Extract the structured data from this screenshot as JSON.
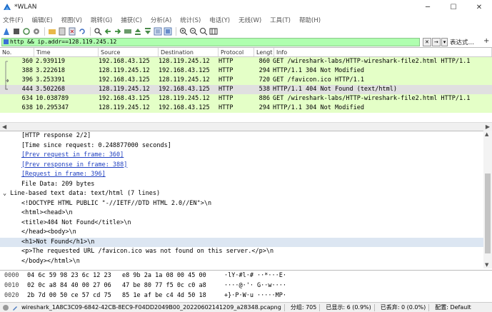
{
  "window": {
    "title": "*WLAN",
    "minimize": "─",
    "maximize": "☐",
    "close": "✕"
  },
  "menu": [
    "文件(F)",
    "编辑(E)",
    "视图(V)",
    "跳转(G)",
    "捕获(C)",
    "分析(A)",
    "统计(S)",
    "电话(Y)",
    "无线(W)",
    "工具(T)",
    "帮助(H)"
  ],
  "filter": {
    "value": "http && ip.addr==128.119.245.12",
    "clear": "✕",
    "apply": "→",
    "dropdown": "▾",
    "expressions_label": "表达式…",
    "add_label": "+"
  },
  "packet_list": {
    "headers": {
      "no": "No.",
      "time": "Time",
      "source": "Source",
      "destination": "Destination",
      "protocol": "Protocol",
      "length": "Lengt",
      "info": "Info"
    },
    "rows": [
      {
        "no": "360",
        "time": "2.939119",
        "source": "192.168.43.125",
        "destination": "128.119.245.12",
        "protocol": "HTTP",
        "length": "860",
        "info": "GET /wireshark-labs/HTTP-wireshark-file2.html HTTP/1.1"
      },
      {
        "no": "388",
        "time": "3.222618",
        "source": "128.119.245.12",
        "destination": "192.168.43.125",
        "protocol": "HTTP",
        "length": "294",
        "info": "HTTP/1.1 304 Not Modified"
      },
      {
        "no": "396",
        "time": "3.253391",
        "source": "192.168.43.125",
        "destination": "128.119.245.12",
        "protocol": "HTTP",
        "length": "720",
        "info": "GET /favicon.ico HTTP/1.1"
      },
      {
        "no": "444",
        "time": "3.502268",
        "source": "128.119.245.12",
        "destination": "192.168.43.125",
        "protocol": "HTTP",
        "length": "538",
        "info": "HTTP/1.1 404 Not Found  (text/html)"
      },
      {
        "no": "634",
        "time": "10.038789",
        "source": "192.168.43.125",
        "destination": "128.119.245.12",
        "protocol": "HTTP",
        "length": "886",
        "info": "GET /wireshark-labs/HTTP-wireshark-file2.html HTTP/1.1"
      },
      {
        "no": "638",
        "time": "10.295347",
        "source": "128.119.245.12",
        "destination": "192.168.43.125",
        "protocol": "HTTP",
        "length": "294",
        "info": "HTTP/1.1 304 Not Modified"
      }
    ]
  },
  "details": {
    "lines": [
      "[HTTP response 2/2]",
      "[Time since request: 0.248877000 seconds]",
      "[Prev request in frame: 360]",
      "[Prev response in frame: 388]",
      "[Request in frame: 396]",
      "File Data: 209 bytes",
      "Line-based text data: text/html (7 lines)",
      "<!DOCTYPE HTML PUBLIC \"-//IETF//DTD HTML 2.0//EN\">\\n",
      "<html><head>\\n",
      "<title>404 Not Found</title>\\n",
      "</head><body>\\n",
      "<h1>Not Found</h1>\\n",
      "<p>The requested URL /favicon.ico was not found on this server.</p>\\n",
      "</body></html>\\n"
    ]
  },
  "bytes": {
    "rows": [
      {
        "offset": "0000",
        "hex": "04 6c 59 98 23 6c 12 23   e8 9b 2a 1a 08 00 45 00",
        "ascii": "·lY·#l·# ··*···E·"
      },
      {
        "offset": "0010",
        "hex": "02 0c a8 84 40 00 27 06   47 be 80 77 f5 0c c0 a8",
        "ascii": "····@·'· G··w····"
      },
      {
        "offset": "0020",
        "hex": "2b 7d 00 50 ce 57 cd 75   85 1e af be c4 4d 50 18",
        "ascii": "+}·P·W·u ·····MP·"
      }
    ]
  },
  "status": {
    "file": "wireshark_1A8C3C09-6842-42CB-8EC9-F04DD2049B00_20220602141209_a28348.pcapng",
    "packets": "分组: 705",
    "displayed": "已显示: 6 (0.9%)",
    "dropped": "已丢弃: 0 (0.0%)",
    "profile": "配置: Default"
  }
}
